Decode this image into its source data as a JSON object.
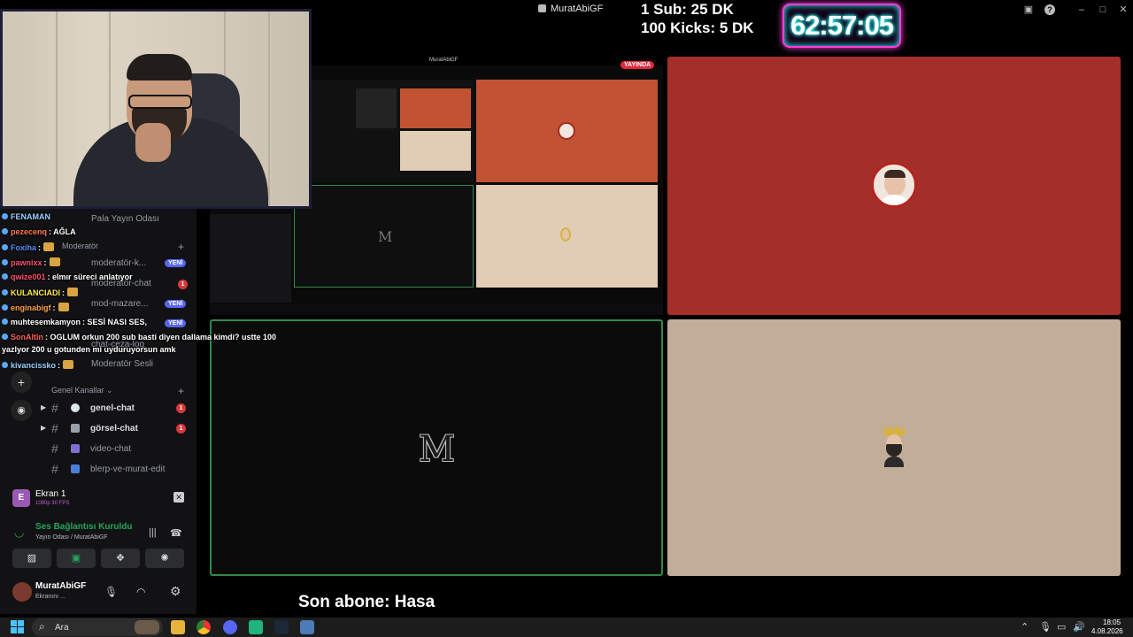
{
  "window": {
    "title": "MuratAbiGF"
  },
  "overlay": {
    "goal_line1": "1 Sub: 25 DK",
    "goal_line2": "100 Kicks: 5 DK",
    "timer": "62:57:05",
    "sub_ticker": "Son abone: Hasa"
  },
  "chat": [
    {
      "user": "FENAMAN",
      "text": "",
      "color": "#9ad0ff"
    },
    {
      "user": "pezecenq",
      "text": ": AĞLA",
      "color": "#ff7b54"
    },
    {
      "user": "Foxiha",
      "text": ":",
      "color": "#5a8cff"
    },
    {
      "user": "pawnixx",
      "text": ":",
      "color": "#ff4f6d"
    },
    {
      "user": "qwize001",
      "text": ": elmır süreci anlatıyor",
      "color": "#ff4f6d"
    },
    {
      "user": "KULANCIADI",
      "text": ":",
      "color": "#ffea4d"
    },
    {
      "user": "enginabigf",
      "text": ":",
      "color": "#ffa34d"
    },
    {
      "user": "muhtesemkamyon",
      "text": ": SESİ NASI SES,",
      "color": "#ffffff"
    },
    {
      "user": "SonAltin",
      "text": ": OGLUM orkun 200 sub basti diyen dallama kimdi? ustte 100",
      "color": "#ff5f5f"
    },
    {
      "user": "",
      "text": "yazlyor 200 u gotunden mi uyduruyorsun amk",
      "color": "#ffffff"
    },
    {
      "user": "kivancissko",
      "text": ":",
      "color": "#9ad0ff"
    }
  ],
  "discord": {
    "ghost_channels": {
      "pala": "Pala Yayın Odası",
      "moderator_cat": "Moderatör",
      "moderator_k": "moderatör-k...",
      "moderator_chat": "moderatör-chat",
      "mod_mazare": "mod-mazare...",
      "chat_ceza": "chat-ceza-log",
      "moderator_sesli": "Moderatör Sesli",
      "yeni": "YENİ",
      "badge": "1"
    },
    "category": "Genel Kanallar",
    "channels": [
      {
        "name": "genel-chat",
        "badge": "1",
        "emoji_color": "#dfe3ea",
        "dim": false
      },
      {
        "name": "görsel-chat",
        "badge": "1",
        "emoji_color": "#9aa0a8",
        "dim": false
      },
      {
        "name": "video-chat",
        "badge": "",
        "emoji_color": "#7e6fd0",
        "dim": true
      },
      {
        "name": "blerp-ve-murat-edit",
        "badge": "",
        "emoji_color": "#4a7fd8",
        "dim": true
      }
    ],
    "screen_share": {
      "initial": "E",
      "name": "Ekran 1",
      "quality": "1080p 30 FPS"
    },
    "voice": {
      "status": "Ses Bağlantısı Kuruldu",
      "location": "Yayın Odası / MuratAbiGF"
    },
    "user": {
      "name": "MuratAbiGF",
      "status": "Ekranını ..."
    }
  },
  "stage": {
    "share_title": "MuratAbiGF",
    "live_badge": "YAYINDA",
    "tile_colors": {
      "red": "#a42f2a",
      "beige": "#c2ad98",
      "dark": "#0b0b0b"
    },
    "placeholder_letter": "M"
  },
  "taskbar": {
    "search_placeholder": "Ara",
    "time": "18:05",
    "date": "4.08.2026"
  }
}
